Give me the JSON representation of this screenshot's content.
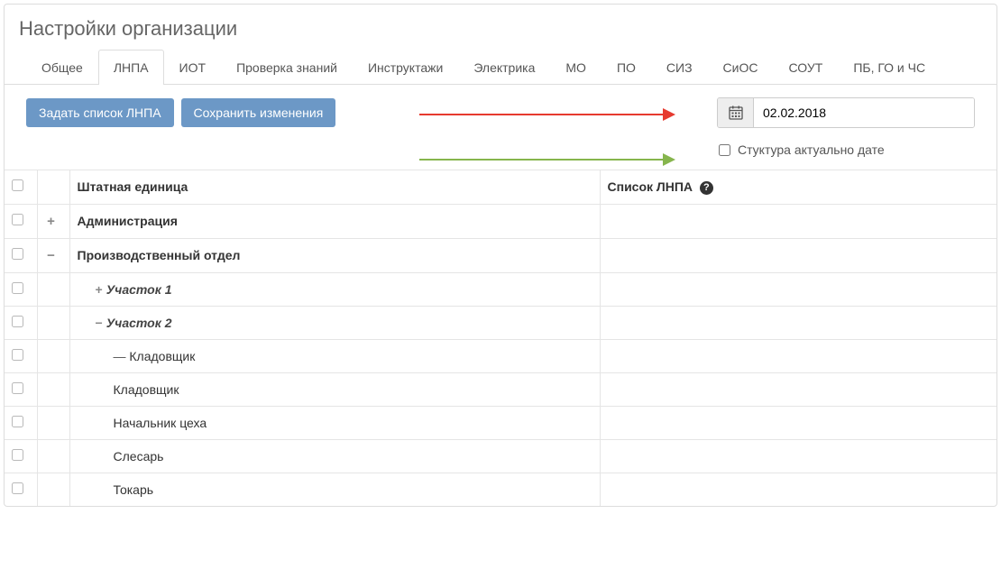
{
  "page_title": "Настройки организации",
  "tabs": [
    {
      "id": "general",
      "label": "Общее"
    },
    {
      "id": "lnpa",
      "label": "ЛНПА"
    },
    {
      "id": "iot",
      "label": "ИОТ"
    },
    {
      "id": "knowledge",
      "label": "Проверка знаний"
    },
    {
      "id": "briefings",
      "label": "Инструктажи"
    },
    {
      "id": "electrics",
      "label": "Электрика"
    },
    {
      "id": "mo",
      "label": "МО"
    },
    {
      "id": "po",
      "label": "ПО"
    },
    {
      "id": "siz",
      "label": "СИЗ"
    },
    {
      "id": "sios",
      "label": "СиОС"
    },
    {
      "id": "sout",
      "label": "СОУТ"
    },
    {
      "id": "pbgo",
      "label": "ПБ, ГО и ЧС"
    }
  ],
  "active_tab": "lnpa",
  "toolbar": {
    "set_list_label": "Задать список ЛНПА",
    "save_label": "Сохранить изменения"
  },
  "date": {
    "value": "02.02.2018"
  },
  "structure_checkbox": {
    "label": "Стуктура актуально дате",
    "checked": false
  },
  "table": {
    "col_unit": "Штатная единица",
    "col_lnpa": "Список ЛНПА"
  },
  "rows": [
    {
      "kind": "dept",
      "toggle": "plus",
      "label": "Администрация"
    },
    {
      "kind": "dept",
      "toggle": "minus",
      "label": "Производственный отдел"
    },
    {
      "kind": "sector",
      "toggle": "plus",
      "label": "Участок 1"
    },
    {
      "kind": "sector",
      "toggle": "minus",
      "label": "Участок 2"
    },
    {
      "kind": "pos",
      "dashed": true,
      "label": "Кладовщик"
    },
    {
      "kind": "pos",
      "label": "Кладовщик"
    },
    {
      "kind": "pos",
      "label": "Начальник цеха"
    },
    {
      "kind": "pos",
      "label": "Слесарь"
    },
    {
      "kind": "pos",
      "label": "Токарь"
    }
  ]
}
